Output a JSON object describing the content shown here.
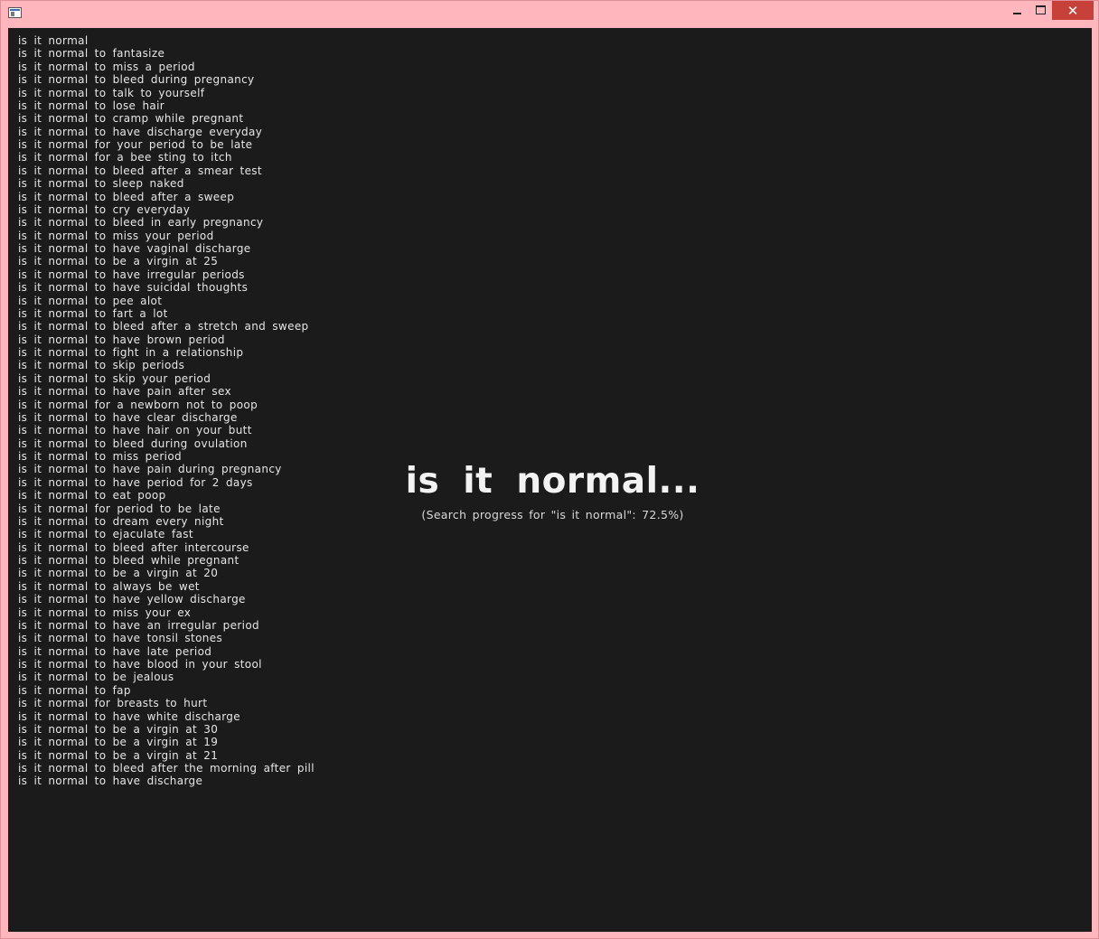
{
  "window": {
    "title": "",
    "controls": {
      "minimize_icon": "minimize-icon",
      "maximize_icon": "maximize-icon",
      "close_label": "✕"
    },
    "colors": {
      "frame": "#ffb6bd",
      "close_button": "#c7413a",
      "client_background": "#1b1b1b",
      "text": "#e6e6e6"
    }
  },
  "main": {
    "title": "is it normal...",
    "progress_text": "(Search progress for \"is it normal\": 72.5%)",
    "progress_percent": 72.5
  },
  "results": [
    "is it normal",
    "is it normal to fantasize",
    "is it normal to miss a period",
    "is it normal to bleed during pregnancy",
    "is it normal to talk to yourself",
    "is it normal to lose hair",
    "is it normal to cramp while pregnant",
    "is it normal to have discharge everyday",
    "is it normal for your period to be late",
    "is it normal for a bee sting to itch",
    "is it normal to bleed after a smear test",
    "is it normal to sleep naked",
    "is it normal to bleed after a sweep",
    "is it normal to cry everyday",
    "is it normal to bleed in early pregnancy",
    "is it normal to miss your period",
    "is it normal to have vaginal discharge",
    "is it normal to be a virgin at 25",
    "is it normal to have irregular periods",
    "is it normal to have suicidal thoughts",
    "is it normal to pee alot",
    "is it normal to fart a lot",
    "is it normal to bleed after a stretch and sweep",
    "is it normal to have brown period",
    "is it normal to fight in a relationship",
    "is it normal to skip periods",
    "is it normal to skip your period",
    "is it normal to have pain after sex",
    "is it normal for a newborn not to poop",
    "is it normal to have clear discharge",
    "is it normal to have hair on your butt",
    "is it normal to bleed during ovulation",
    "is it normal to miss period",
    "is it normal to have pain during pregnancy",
    "is it normal to have period for 2 days",
    "is it normal to eat poop",
    "is it normal for period to be late",
    "is it normal to dream every night",
    "is it normal to ejaculate fast",
    "is it normal to bleed after intercourse",
    "is it normal to bleed while pregnant",
    "is it normal to be a virgin at 20",
    "is it normal to always be wet",
    "is it normal to have yellow discharge",
    "is it normal to miss your ex",
    "is it normal to have an irregular period",
    "is it normal to have tonsil stones",
    "is it normal to have late period",
    "is it normal to have blood in your stool",
    "is it normal to be jealous",
    "is it normal to fap",
    "is it normal for breasts to hurt",
    "is it normal to have white discharge",
    "is it normal to be a virgin at 30",
    "is it normal to be a virgin at 19",
    "is it normal to be a virgin at 21",
    "is it normal to bleed after the morning after pill",
    "is it normal to have discharge"
  ]
}
